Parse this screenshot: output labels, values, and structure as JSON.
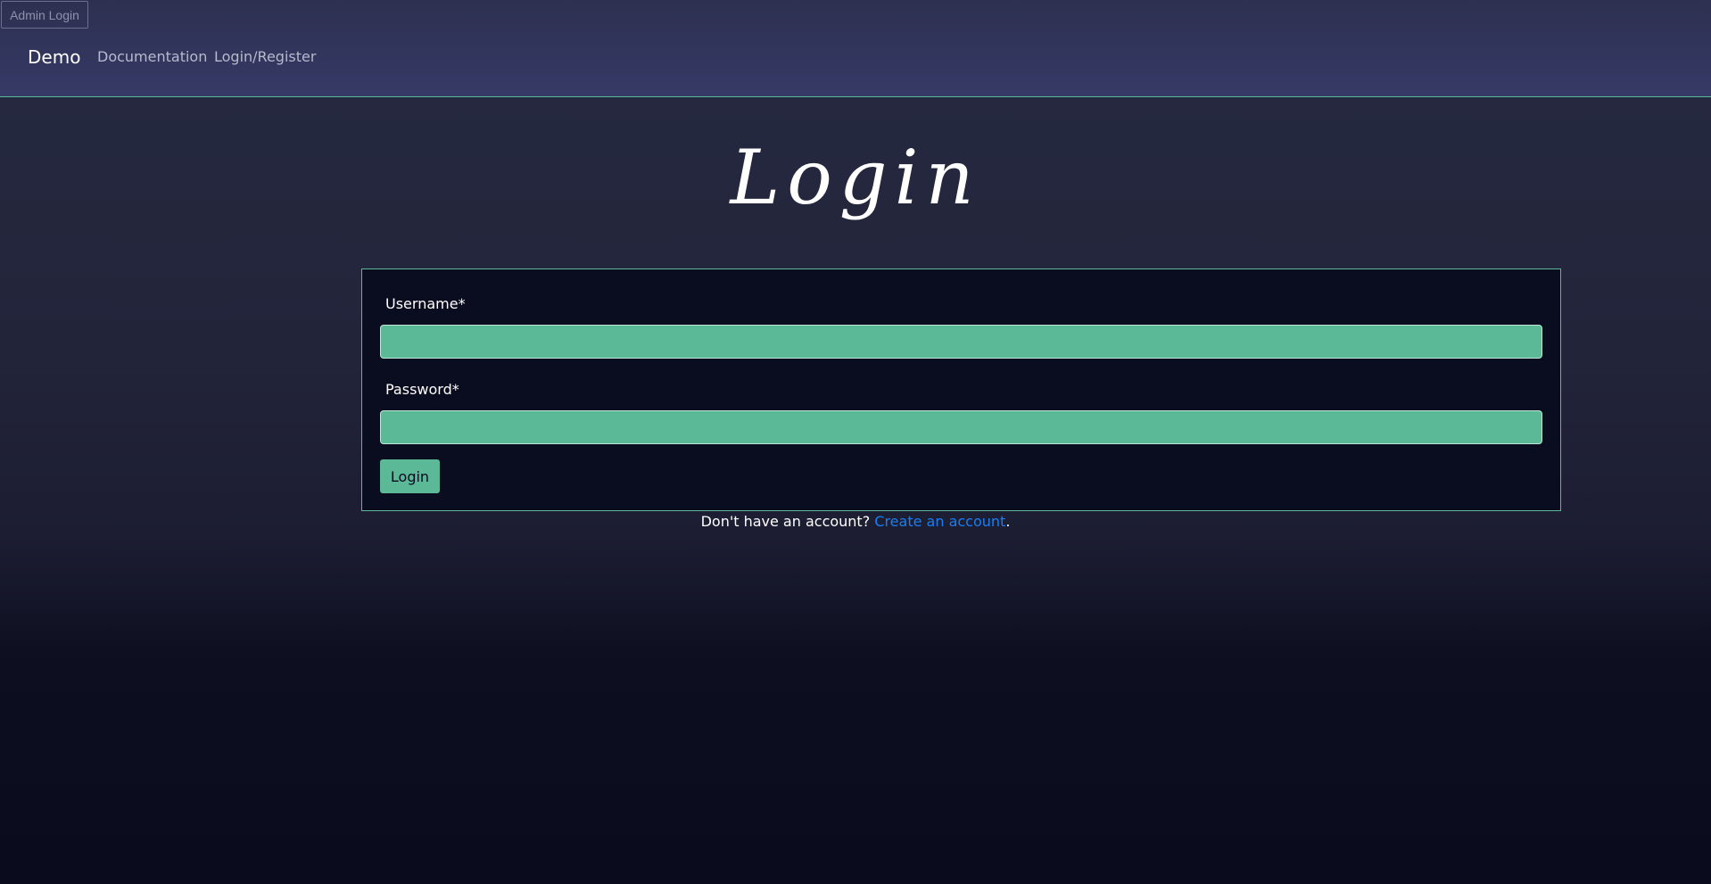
{
  "admin_button": {
    "label": "Admin Login"
  },
  "navbar": {
    "brand": "Demo",
    "links": [
      {
        "label": "Documentation"
      },
      {
        "label": "Login/Register"
      }
    ]
  },
  "page": {
    "title": "Login"
  },
  "form": {
    "username_label": "Username*",
    "username_value": "",
    "password_label": "Password*",
    "password_value": "",
    "submit_label": "Login"
  },
  "register": {
    "prompt": "Don't have an account? ",
    "link_label": "Create an account",
    "suffix": "."
  },
  "colors": {
    "accent": "#5bb998",
    "link": "#1a7ef2",
    "navbar": "#363a66",
    "card": "#0a0c1f"
  }
}
